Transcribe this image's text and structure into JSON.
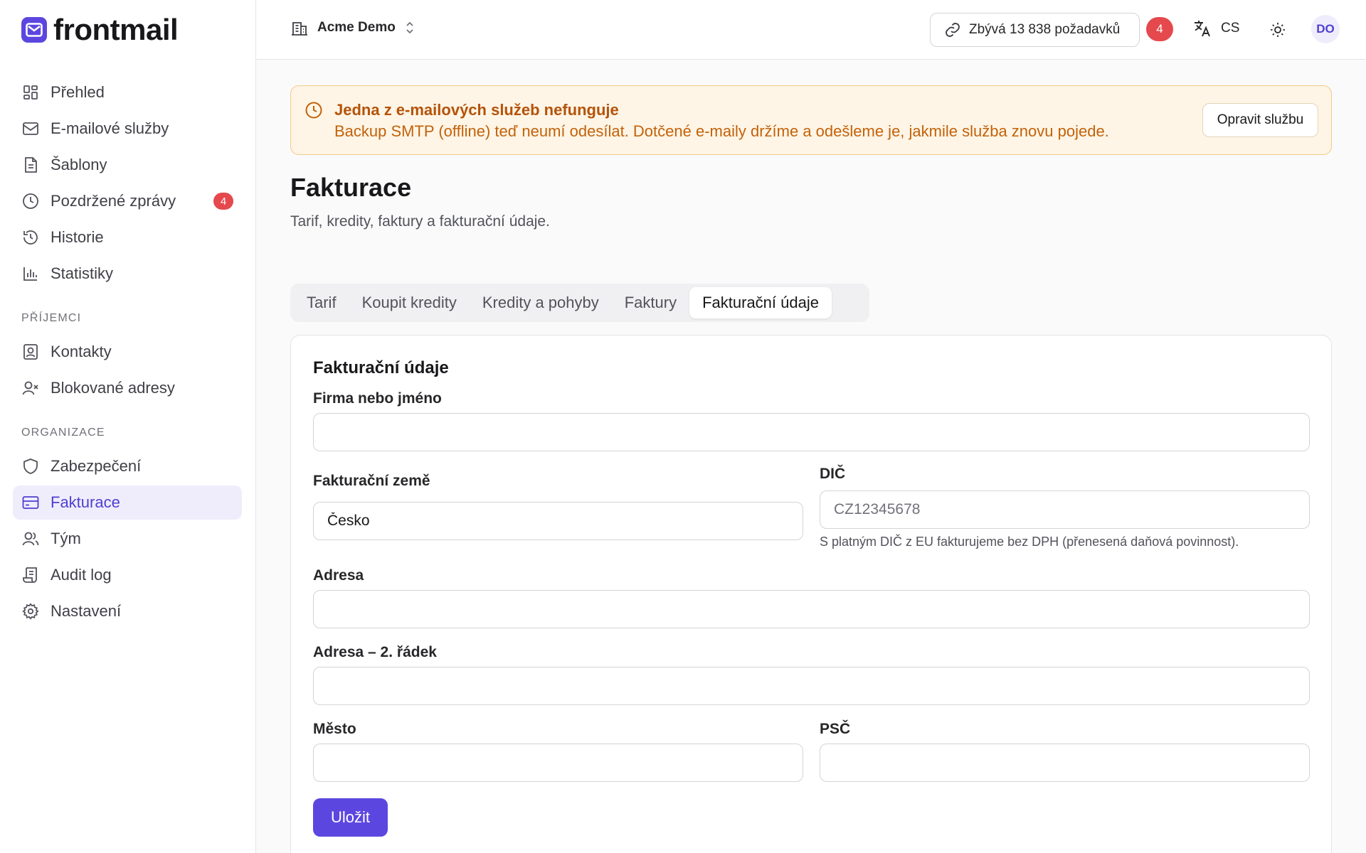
{
  "brand": {
    "name": "frontmail",
    "accent": "#5b47e0"
  },
  "sidebar": {
    "items": [
      {
        "label": "Přehled",
        "icon": "dashboard-icon"
      },
      {
        "label": "E-mailové služby",
        "icon": "mail-icon"
      },
      {
        "label": "Šablony",
        "icon": "document-icon"
      },
      {
        "label": "Pozdržené zprávy",
        "icon": "clock-icon",
        "badge": "4"
      },
      {
        "label": "Historie",
        "icon": "history-icon"
      },
      {
        "label": "Statistiky",
        "icon": "bar-chart-icon"
      }
    ],
    "section_recipients": "PŘÍJEMCI",
    "recipients_items": [
      {
        "label": "Kontakty",
        "icon": "contact-card-icon"
      },
      {
        "label": "Blokované adresy",
        "icon": "user-blocked-icon"
      }
    ],
    "section_org": "ORGANIZACE",
    "org_items": [
      {
        "label": "Zabezpečení",
        "icon": "shield-icon"
      },
      {
        "label": "Fakturace",
        "icon": "credit-card-icon",
        "active": true
      },
      {
        "label": "Tým",
        "icon": "users-icon"
      },
      {
        "label": "Audit log",
        "icon": "scroll-icon"
      },
      {
        "label": "Nastavení",
        "icon": "gear-icon"
      }
    ]
  },
  "header": {
    "org_name": "Acme Demo",
    "quota_text": "Zbývá 13 838 požadavků",
    "notification_count": "4",
    "language": "CS",
    "avatar_initials": "DO"
  },
  "alert": {
    "title": "Jedna z e-mailových služeb nefunguje",
    "text": "Backup SMTP (offline) teď neumí odesílat. Dotčené e-maily držíme a odešleme je, jakmile služba znovu pojede.",
    "button": "Opravit službu"
  },
  "page": {
    "title": "Fakturace",
    "subtitle": "Tarif, kredity, faktury a fakturační údaje."
  },
  "tabs": [
    {
      "label": "Tarif"
    },
    {
      "label": "Koupit kredity"
    },
    {
      "label": "Kredity a pohyby"
    },
    {
      "label": "Faktury"
    },
    {
      "label": "Fakturační údaje",
      "active": true
    }
  ],
  "form": {
    "title": "Fakturační údaje",
    "company_label": "Firma nebo jméno",
    "company_value": "",
    "country_label": "Fakturační země",
    "country_value": "Česko",
    "vat_label": "DIČ",
    "vat_value": "",
    "vat_placeholder": "CZ12345678",
    "vat_hint": "S platným DIČ z EU fakturujeme bez DPH (přenesená daňová povinnost).",
    "address_label": "Adresa",
    "address_value": "",
    "address2_label": "Adresa – 2. řádek",
    "address2_value": "",
    "city_label": "Město",
    "city_value": "",
    "zip_label": "PSČ",
    "zip_value": "",
    "save_label": "Uložit"
  }
}
